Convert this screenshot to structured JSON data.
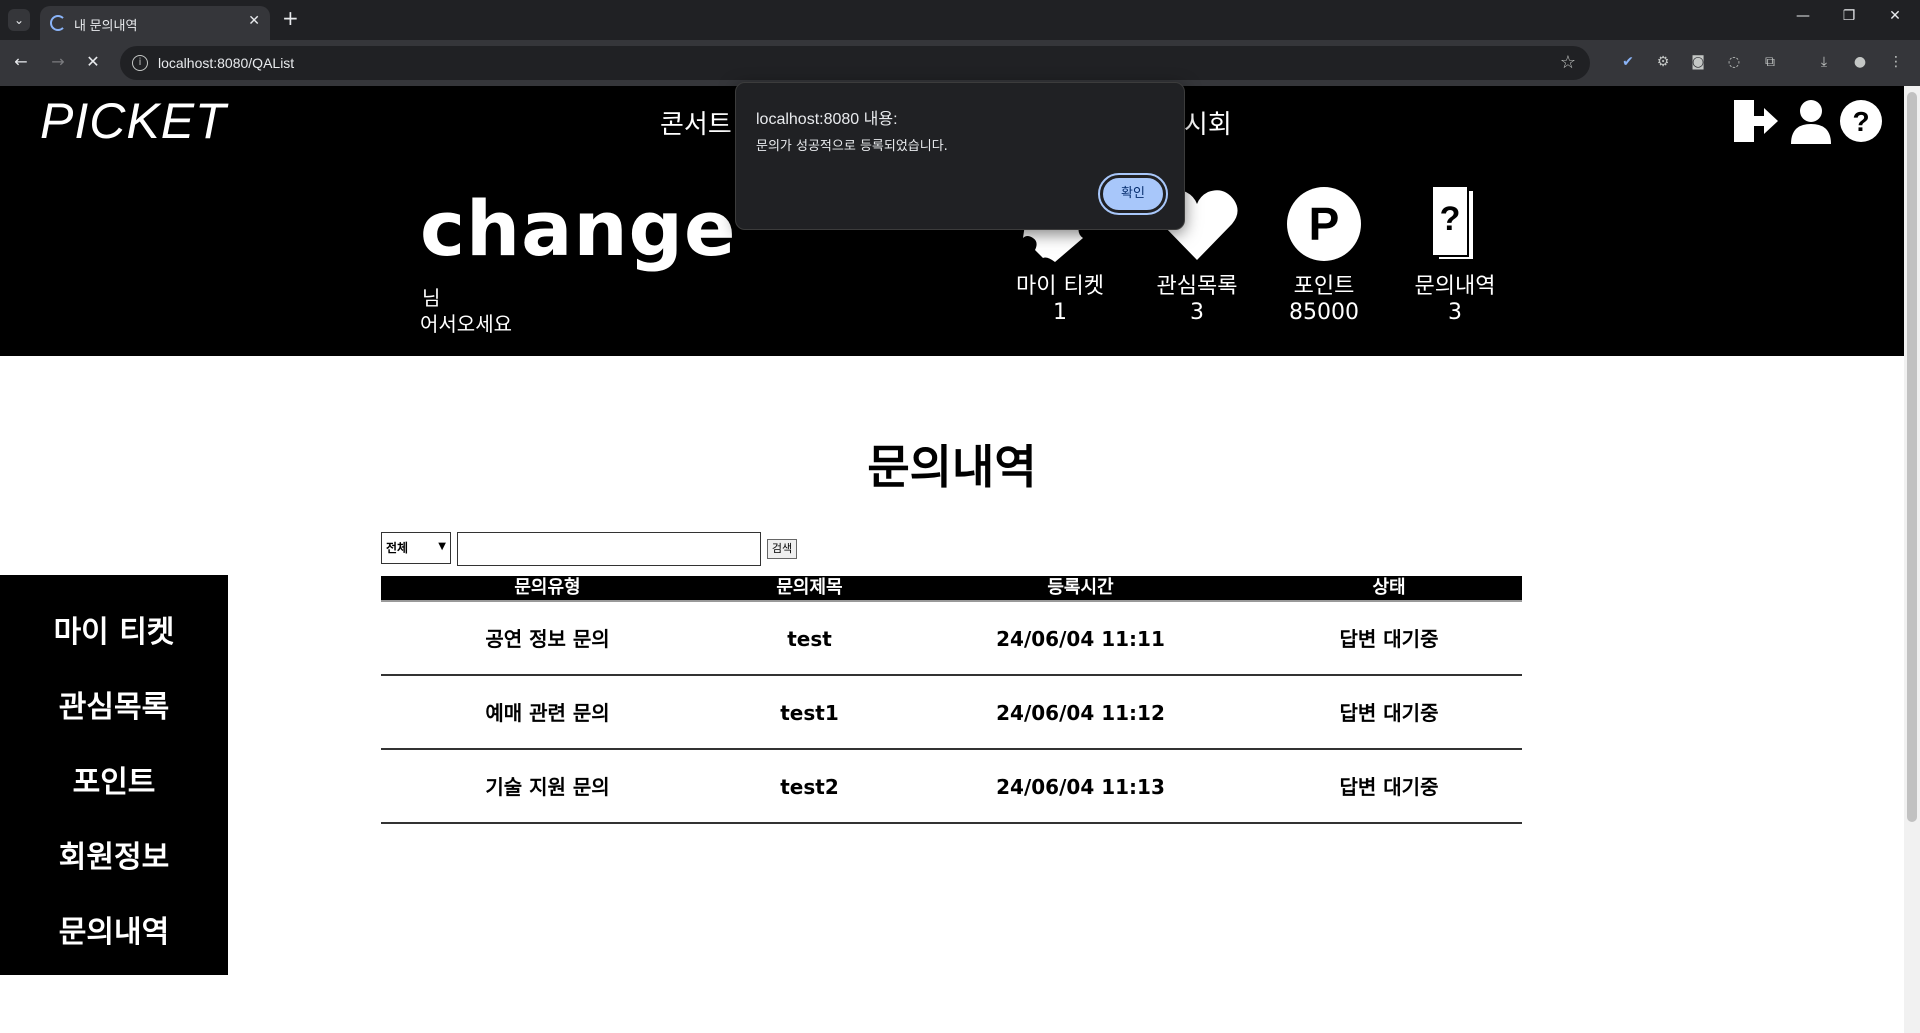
{
  "browser": {
    "tab_title": "내 문의내역",
    "url": "localhost:8080/QAList"
  },
  "header": {
    "logo": "PICKET",
    "nav_left": "콘서트",
    "nav_right": "전시회"
  },
  "profile": {
    "username": "change",
    "suffix": "님",
    "welcome": "어서오세요",
    "stats": [
      {
        "label": "마이 티켓",
        "value": "1",
        "icon": "ticket-icon"
      },
      {
        "label": "관심목록",
        "value": "3",
        "icon": "heart-icon"
      },
      {
        "label": "포인트",
        "value": "85000",
        "icon": "point-icon"
      },
      {
        "label": "문의내역",
        "value": "3",
        "icon": "inquiry-icon"
      }
    ]
  },
  "main": {
    "title": "문의내역",
    "search": {
      "select_value": "전체",
      "button_label": "검색"
    },
    "table": {
      "headers": [
        "문의유형",
        "문의제목",
        "등록시간",
        "상태"
      ],
      "rows": [
        [
          "공연 정보 문의",
          "test",
          "24/06/04 11:11",
          "답변 대기중"
        ],
        [
          "예매 관련 문의",
          "test1",
          "24/06/04 11:12",
          "답변 대기중"
        ],
        [
          "기술 지원 문의",
          "test2",
          "24/06/04 11:13",
          "답변 대기중"
        ]
      ]
    }
  },
  "sidebar": {
    "items": [
      "마이 티켓",
      "관심목록",
      "포인트",
      "회원정보",
      "문의내역"
    ]
  },
  "dialog": {
    "title": "localhost:8080 내용:",
    "message": "문의가 성공적으로 등록되었습니다.",
    "ok_label": "확인"
  }
}
